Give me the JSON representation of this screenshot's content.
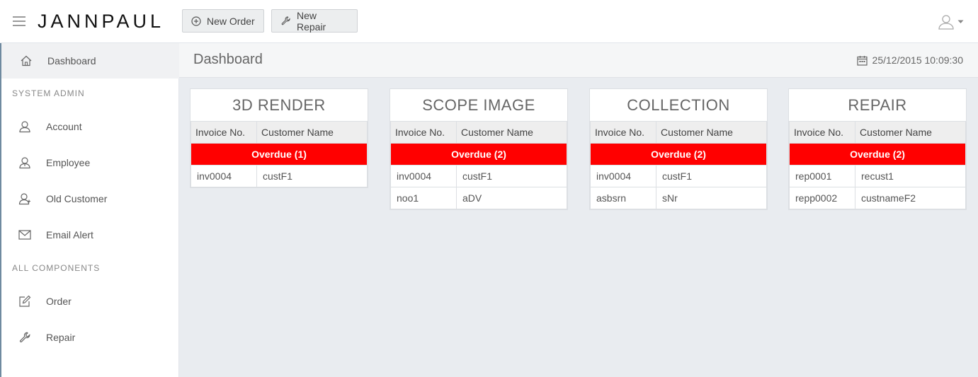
{
  "header": {
    "brand": "JANNPAUL",
    "buttons": {
      "new_order": "New Order",
      "new_repair": "New Repair"
    }
  },
  "sidebar": {
    "dashboard": "Dashboard",
    "section_system_admin": "SYSTEM ADMIN",
    "account": "Account",
    "employee": "Employee",
    "old_customer": "Old Customer",
    "email_alert": "Email Alert",
    "section_all_components": "ALL COMPONENTS",
    "order": "Order",
    "repair": "Repair"
  },
  "page": {
    "title": "Dashboard",
    "datetime": "25/12/2015 10:09:30"
  },
  "columns": {
    "invoice": "Invoice No.",
    "customer": "Customer Name"
  },
  "cards": [
    {
      "title": "3D RENDER",
      "overdue": "Overdue (1)",
      "rows": [
        [
          "inv0004",
          "custF1"
        ]
      ]
    },
    {
      "title": "SCOPE IMAGE",
      "overdue": "Overdue (2)",
      "rows": [
        [
          "inv0004",
          "custF1"
        ],
        [
          "noo1",
          "aDV"
        ]
      ]
    },
    {
      "title": "COLLECTION",
      "overdue": "Overdue (2)",
      "rows": [
        [
          "inv0004",
          "custF1"
        ],
        [
          "asbsrn",
          "sNr"
        ]
      ]
    },
    {
      "title": "REPAIR",
      "overdue": "Overdue (2)",
      "rows": [
        [
          "rep0001",
          "recust1"
        ],
        [
          "repp0002",
          "custnameF2"
        ]
      ]
    }
  ],
  "colors": {
    "overdue": "#ff0000",
    "background": "#e9ecf0"
  }
}
